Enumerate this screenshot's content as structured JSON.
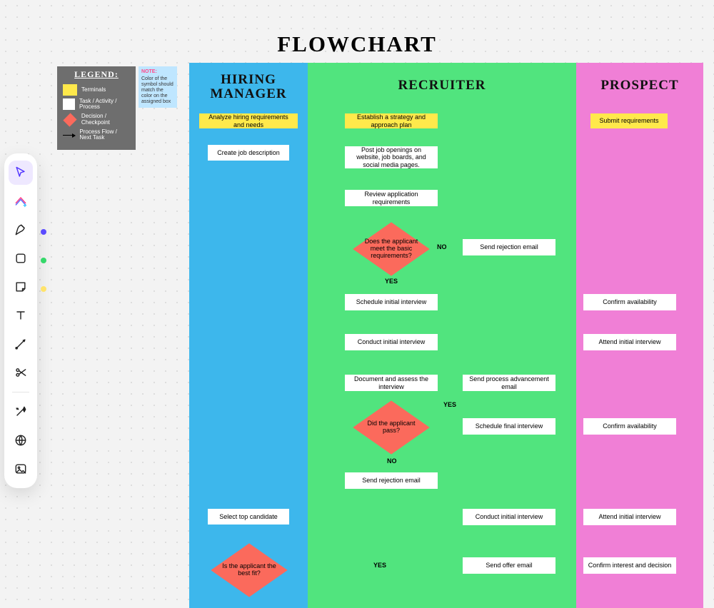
{
  "title": "FLOWCHART",
  "toolbar": {
    "items": [
      {
        "name": "pointer-tool",
        "label": "Pointer"
      },
      {
        "name": "ai-tool",
        "label": "AI Generate"
      },
      {
        "name": "pen-tool",
        "label": "Pen"
      },
      {
        "name": "shape-tool",
        "label": "Shape"
      },
      {
        "name": "sticky-tool",
        "label": "Sticky Note"
      },
      {
        "name": "text-tool",
        "label": "Text"
      },
      {
        "name": "connector-tool",
        "label": "Connector"
      },
      {
        "name": "scissors-tool",
        "label": "Scissors"
      },
      {
        "name": "sparkle-tool",
        "label": "Magic"
      },
      {
        "name": "globe-tool",
        "label": "Web"
      },
      {
        "name": "image-tool",
        "label": "Image"
      }
    ]
  },
  "legend": {
    "title": "LEGEND:",
    "terminals": "Terminals",
    "process": "Task / Activity / Process",
    "decision": "Decision / Checkpoint",
    "flow": "Process Flow / Next Task"
  },
  "note": {
    "heading": "NOTE:",
    "body": "Color of the symbol should match the color on the assigned box"
  },
  "lanes": {
    "hiring": "HIRING\nMANAGER",
    "recruiter": "RECRUITER",
    "prospect": "PROSPECT"
  },
  "nodes": {
    "analyze": "Analyze hiring requirements and needs",
    "create_desc": "Create job description",
    "strategy": "Establish a strategy and approach plan",
    "post_openings": "Post job openings on website, job boards, and social media pages.",
    "review_reqs": "Review application requirements",
    "meets_basic_q": "Does the applicant meet the basic requirements?",
    "rejection1": "Send rejection email",
    "schedule_initial": "Schedule initial interview",
    "conduct_initial": "Conduct initial interview",
    "doc_assess": "Document and assess the interview",
    "adv_email": "Send process advancement email",
    "did_pass_q": "Did the applicant pass?",
    "schedule_final": "Schedule final interview",
    "rejection2": "Send rejection email",
    "conduct_initial_2": "Conduct initial interview",
    "send_offer": "Send offer email",
    "select_top": "Select top candidate",
    "best_fit_q": "Is the applicant the best fit?",
    "submit_reqs": "Submit requirements",
    "confirm_avail1": "Confirm availability",
    "attend_initial1": "Attend initial interview",
    "confirm_avail2": "Confirm availability",
    "attend_initial2": "Attend initial interview",
    "confirm_interest": "Confirm interest and decision",
    "YES": "YES",
    "NO": "NO"
  }
}
